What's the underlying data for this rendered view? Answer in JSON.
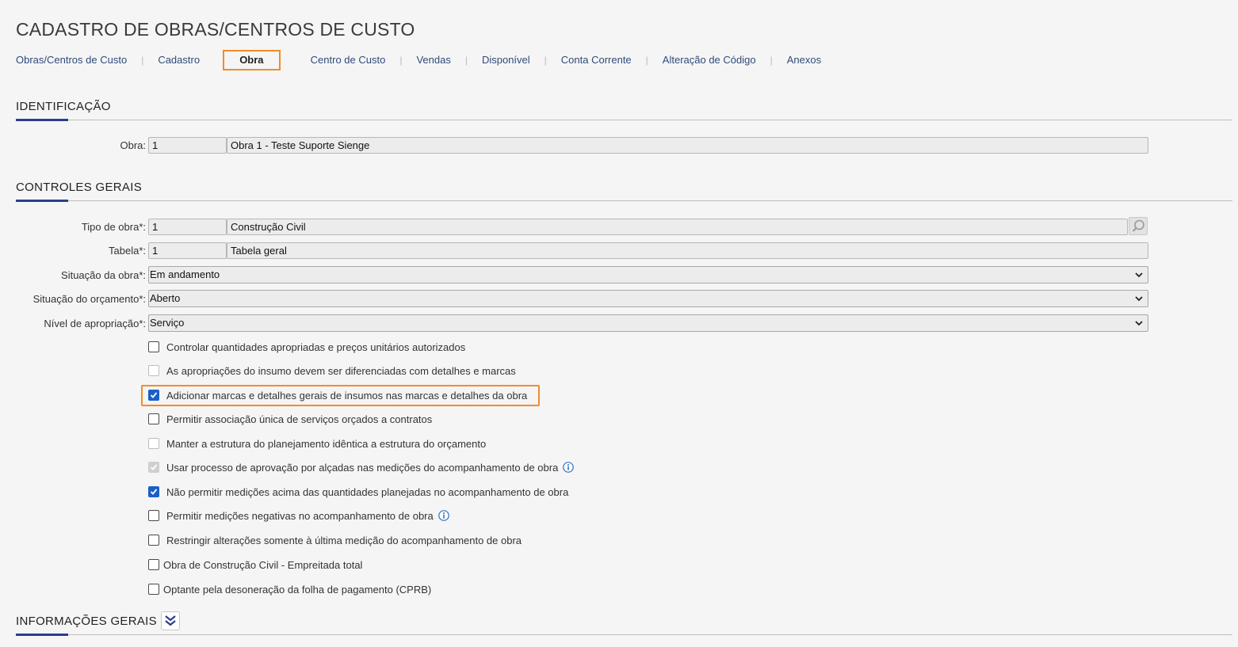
{
  "page": {
    "title": "CADASTRO DE OBRAS/CENTROS DE CUSTO"
  },
  "tabs": [
    {
      "label": "Obras/Centros de Custo"
    },
    {
      "label": "Cadastro"
    },
    {
      "label": "Obra",
      "active": true
    },
    {
      "label": "Centro de Custo"
    },
    {
      "label": "Vendas"
    },
    {
      "label": "Disponível"
    },
    {
      "label": "Conta Corrente"
    },
    {
      "label": "Alteração de Código"
    },
    {
      "label": "Anexos"
    }
  ],
  "identificacao": {
    "title": "IDENTIFICAÇÃO",
    "obra_label": "Obra:",
    "obra_code": "1",
    "obra_name": "Obra 1 - Teste Suporte Sienge"
  },
  "controles": {
    "title": "CONTROLES GERAIS",
    "tipo_label": "Tipo de obra*:",
    "tipo_code": "1",
    "tipo_name": "Construção Civil",
    "tabela_label": "Tabela*:",
    "tabela_code": "1",
    "tabela_name": "Tabela geral",
    "situacao_obra_label": "Situação da obra*:",
    "situacao_obra_value": "Em andamento",
    "situacao_orcamento_label": "Situação do orçamento*:",
    "situacao_orcamento_value": "Aberto",
    "nivel_label": "Nível de apropriação*:",
    "nivel_value": "Serviço",
    "checkboxes": [
      {
        "label": "Controlar quantidades apropriadas e preços unitários autorizados",
        "state": "unchecked"
      },
      {
        "label": "As apropriações do insumo devem ser diferenciadas com detalhes e marcas",
        "state": "disabled"
      },
      {
        "label": "Adicionar marcas e detalhes gerais de insumos nas marcas e detalhes da obra",
        "state": "checked"
      },
      {
        "label": "Permitir associação única de serviços orçados a contratos",
        "state": "unchecked"
      },
      {
        "label": "Manter a estrutura do planejamento idêntica a estrutura do orçamento",
        "state": "disabled"
      },
      {
        "label": "Usar processo de aprovação por alçadas nas medições do acompanhamento de obra",
        "state": "checked-disabled",
        "info": true
      },
      {
        "label": "Não permitir medições acima das quantidades planejadas no acompanhamento de obra",
        "state": "checked"
      },
      {
        "label": "Permitir medições negativas no acompanhamento de obra",
        "state": "unchecked",
        "info": true
      },
      {
        "label": "Restringir alterações somente à última medição do acompanhamento de obra",
        "state": "unchecked"
      },
      {
        "label": "Obra de Construção Civil - Empreitada total",
        "state": "unchecked"
      },
      {
        "label": "Optante pela desoneração da folha de pagamento (CPRB)",
        "state": "unchecked"
      }
    ]
  },
  "informacoes": {
    "title": "INFORMAÇÕES GERAIS"
  },
  "colors": {
    "accent": "#2c3e8c",
    "highlight": "#f28c28",
    "checkbox": "#1a5fc8"
  }
}
